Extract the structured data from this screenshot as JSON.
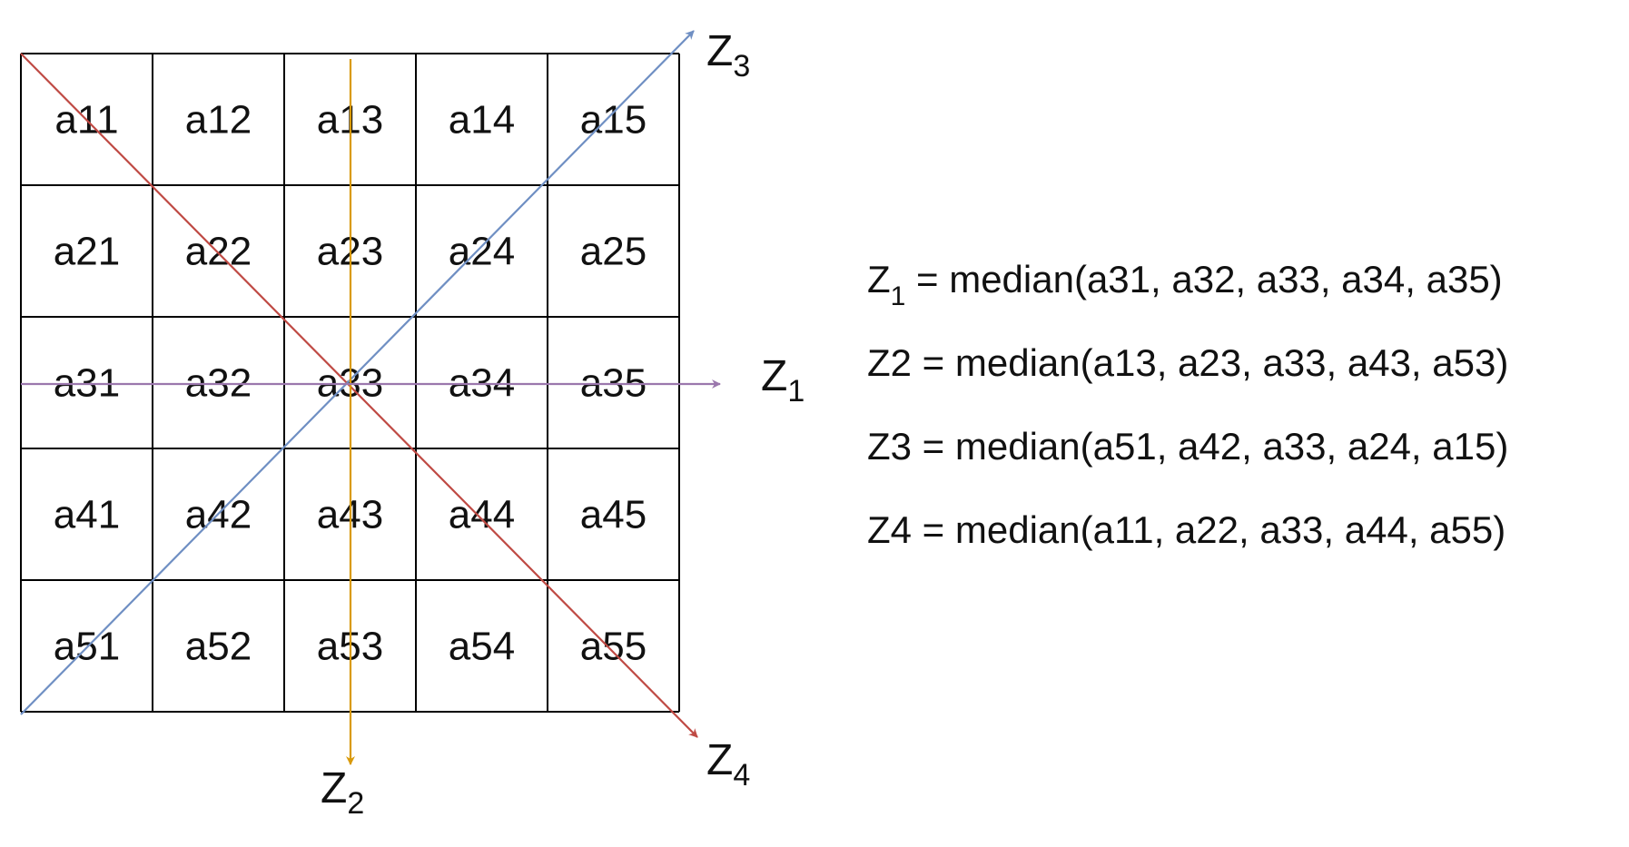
{
  "grid": {
    "rows": [
      [
        "a11",
        "a12",
        "a13",
        "a14",
        "a15"
      ],
      [
        "a21",
        "a22",
        "a23",
        "a24",
        "a25"
      ],
      [
        "a31",
        "a32",
        "a33",
        "a34",
        "a35"
      ],
      [
        "a41",
        "a42",
        "a43",
        "a44",
        "a45"
      ],
      [
        "a51",
        "a52",
        "a53",
        "a54",
        "a55"
      ]
    ]
  },
  "axes": {
    "z1": {
      "main": "Z",
      "sub": "1",
      "color": "#9b77ad"
    },
    "z2": {
      "main": "Z",
      "sub": "2",
      "color": "#d99a0a"
    },
    "z3": {
      "main": "Z",
      "sub": "3",
      "color": "#6f8fc3"
    },
    "z4": {
      "main": "Z",
      "sub": "4",
      "color": "#bf4a44"
    }
  },
  "formulas": [
    {
      "name": "Z",
      "sub": "1",
      "rest": " = median(a31, a32, a33, a34, a35)"
    },
    {
      "name": "Z2",
      "sub": "",
      "rest": " = median(a13, a23, a33, a43, a53)"
    },
    {
      "name": "Z3",
      "sub": "",
      "rest": " = median(a51, a42, a33, a24, a15)"
    },
    {
      "name": "Z4",
      "sub": "",
      "rest": " = median(a11, a22, a33, a44, a55)"
    }
  ]
}
